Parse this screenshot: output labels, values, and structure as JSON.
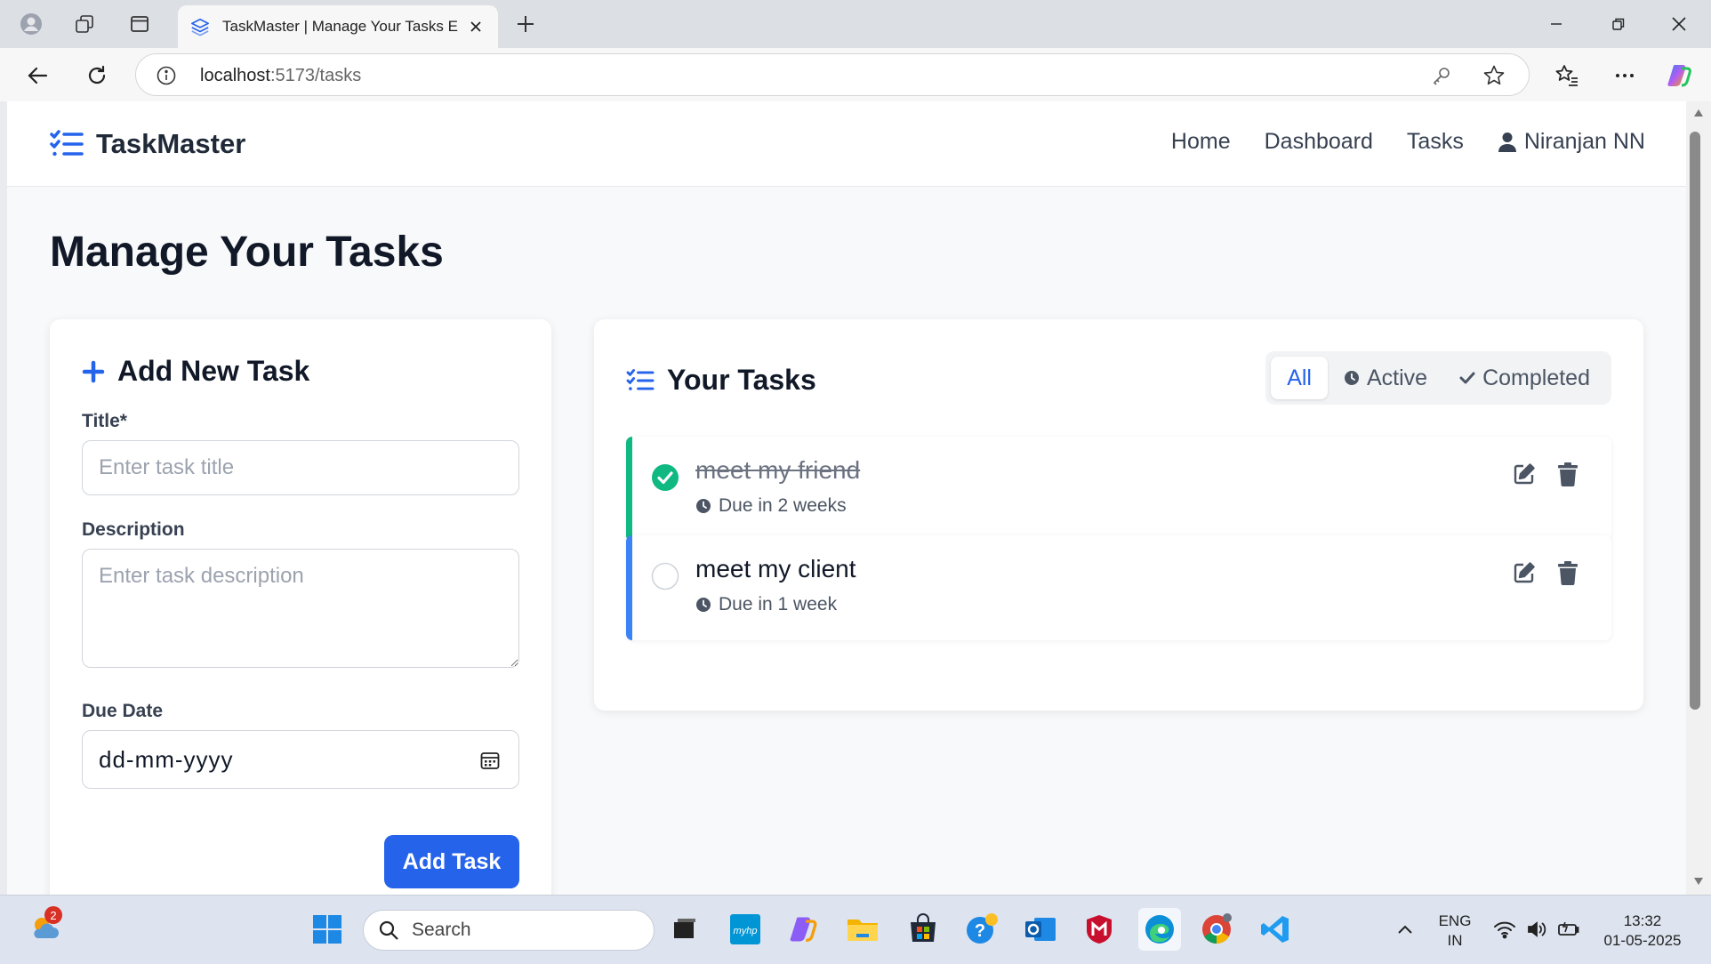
{
  "browser": {
    "tab_title": "TaskMaster | Manage Your Tasks E",
    "url_host": "localhost",
    "url_path": ":5173/tasks"
  },
  "app": {
    "brand": "TaskMaster",
    "nav": [
      "Home",
      "Dashboard",
      "Tasks"
    ],
    "user_name": "Niranjan NN",
    "accent_color": "#2563eb"
  },
  "page": {
    "title": "Manage Your Tasks"
  },
  "form": {
    "heading": "Add New Task",
    "title_label": "Title*",
    "title_placeholder": "Enter task title",
    "description_label": "Description",
    "description_placeholder": "Enter task description",
    "due_label": "Due Date",
    "due_placeholder": "dd-mm-yyyy",
    "submit_label": "Add Task"
  },
  "task_list": {
    "heading": "Your Tasks",
    "filters": [
      {
        "label": "All",
        "active": true
      },
      {
        "label": "Active",
        "active": false
      },
      {
        "label": "Completed",
        "active": false
      }
    ],
    "tasks": [
      {
        "title": "meet my friend",
        "due": "Due in 2 weeks",
        "completed": true,
        "stripe_color": "#10b981"
      },
      {
        "title": "meet my client",
        "due": "Due in 1 week",
        "completed": false,
        "stripe_color": "#3b82f6"
      }
    ]
  },
  "taskbar": {
    "search_placeholder": "Search",
    "weather_badge": "2",
    "lang_line1": "ENG",
    "lang_line2": "IN",
    "time": "13:32",
    "date": "01-05-2025"
  }
}
